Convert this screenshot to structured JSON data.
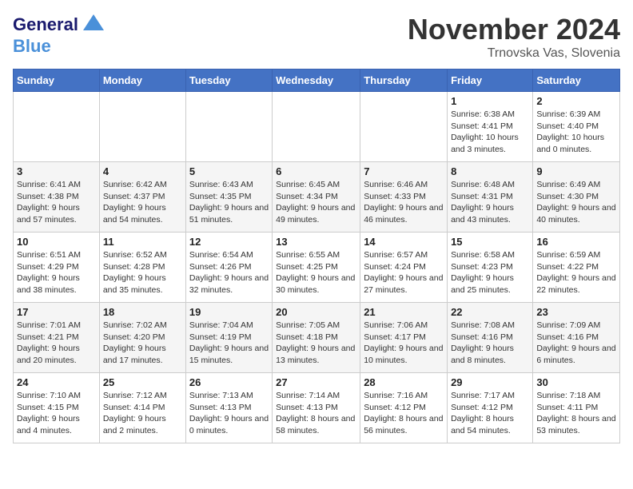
{
  "header": {
    "logo_line1": "General",
    "logo_line2": "Blue",
    "month_title": "November 2024",
    "location": "Trnovska Vas, Slovenia"
  },
  "days_of_week": [
    "Sunday",
    "Monday",
    "Tuesday",
    "Wednesday",
    "Thursday",
    "Friday",
    "Saturday"
  ],
  "weeks": [
    [
      {
        "day": "",
        "info": ""
      },
      {
        "day": "",
        "info": ""
      },
      {
        "day": "",
        "info": ""
      },
      {
        "day": "",
        "info": ""
      },
      {
        "day": "",
        "info": ""
      },
      {
        "day": "1",
        "info": "Sunrise: 6:38 AM\nSunset: 4:41 PM\nDaylight: 10 hours and 3 minutes."
      },
      {
        "day": "2",
        "info": "Sunrise: 6:39 AM\nSunset: 4:40 PM\nDaylight: 10 hours and 0 minutes."
      }
    ],
    [
      {
        "day": "3",
        "info": "Sunrise: 6:41 AM\nSunset: 4:38 PM\nDaylight: 9 hours and 57 minutes."
      },
      {
        "day": "4",
        "info": "Sunrise: 6:42 AM\nSunset: 4:37 PM\nDaylight: 9 hours and 54 minutes."
      },
      {
        "day": "5",
        "info": "Sunrise: 6:43 AM\nSunset: 4:35 PM\nDaylight: 9 hours and 51 minutes."
      },
      {
        "day": "6",
        "info": "Sunrise: 6:45 AM\nSunset: 4:34 PM\nDaylight: 9 hours and 49 minutes."
      },
      {
        "day": "7",
        "info": "Sunrise: 6:46 AM\nSunset: 4:33 PM\nDaylight: 9 hours and 46 minutes."
      },
      {
        "day": "8",
        "info": "Sunrise: 6:48 AM\nSunset: 4:31 PM\nDaylight: 9 hours and 43 minutes."
      },
      {
        "day": "9",
        "info": "Sunrise: 6:49 AM\nSunset: 4:30 PM\nDaylight: 9 hours and 40 minutes."
      }
    ],
    [
      {
        "day": "10",
        "info": "Sunrise: 6:51 AM\nSunset: 4:29 PM\nDaylight: 9 hours and 38 minutes."
      },
      {
        "day": "11",
        "info": "Sunrise: 6:52 AM\nSunset: 4:28 PM\nDaylight: 9 hours and 35 minutes."
      },
      {
        "day": "12",
        "info": "Sunrise: 6:54 AM\nSunset: 4:26 PM\nDaylight: 9 hours and 32 minutes."
      },
      {
        "day": "13",
        "info": "Sunrise: 6:55 AM\nSunset: 4:25 PM\nDaylight: 9 hours and 30 minutes."
      },
      {
        "day": "14",
        "info": "Sunrise: 6:57 AM\nSunset: 4:24 PM\nDaylight: 9 hours and 27 minutes."
      },
      {
        "day": "15",
        "info": "Sunrise: 6:58 AM\nSunset: 4:23 PM\nDaylight: 9 hours and 25 minutes."
      },
      {
        "day": "16",
        "info": "Sunrise: 6:59 AM\nSunset: 4:22 PM\nDaylight: 9 hours and 22 minutes."
      }
    ],
    [
      {
        "day": "17",
        "info": "Sunrise: 7:01 AM\nSunset: 4:21 PM\nDaylight: 9 hours and 20 minutes."
      },
      {
        "day": "18",
        "info": "Sunrise: 7:02 AM\nSunset: 4:20 PM\nDaylight: 9 hours and 17 minutes."
      },
      {
        "day": "19",
        "info": "Sunrise: 7:04 AM\nSunset: 4:19 PM\nDaylight: 9 hours and 15 minutes."
      },
      {
        "day": "20",
        "info": "Sunrise: 7:05 AM\nSunset: 4:18 PM\nDaylight: 9 hours and 13 minutes."
      },
      {
        "day": "21",
        "info": "Sunrise: 7:06 AM\nSunset: 4:17 PM\nDaylight: 9 hours and 10 minutes."
      },
      {
        "day": "22",
        "info": "Sunrise: 7:08 AM\nSunset: 4:16 PM\nDaylight: 9 hours and 8 minutes."
      },
      {
        "day": "23",
        "info": "Sunrise: 7:09 AM\nSunset: 4:16 PM\nDaylight: 9 hours and 6 minutes."
      }
    ],
    [
      {
        "day": "24",
        "info": "Sunrise: 7:10 AM\nSunset: 4:15 PM\nDaylight: 9 hours and 4 minutes."
      },
      {
        "day": "25",
        "info": "Sunrise: 7:12 AM\nSunset: 4:14 PM\nDaylight: 9 hours and 2 minutes."
      },
      {
        "day": "26",
        "info": "Sunrise: 7:13 AM\nSunset: 4:13 PM\nDaylight: 9 hours and 0 minutes."
      },
      {
        "day": "27",
        "info": "Sunrise: 7:14 AM\nSunset: 4:13 PM\nDaylight: 8 hours and 58 minutes."
      },
      {
        "day": "28",
        "info": "Sunrise: 7:16 AM\nSunset: 4:12 PM\nDaylight: 8 hours and 56 minutes."
      },
      {
        "day": "29",
        "info": "Sunrise: 7:17 AM\nSunset: 4:12 PM\nDaylight: 8 hours and 54 minutes."
      },
      {
        "day": "30",
        "info": "Sunrise: 7:18 AM\nSunset: 4:11 PM\nDaylight: 8 hours and 53 minutes."
      }
    ]
  ]
}
